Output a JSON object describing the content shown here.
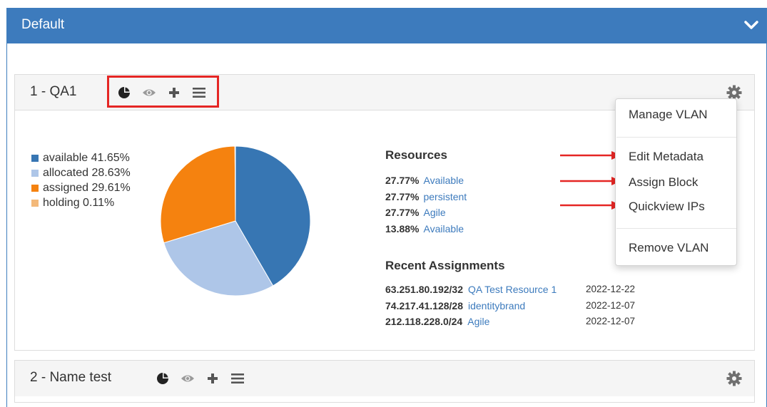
{
  "panel": {
    "title": "Default",
    "collapse_icon": "chevron-down-icon"
  },
  "vlans": [
    {
      "name": "1 - QA1",
      "tools": [
        "pie-chart-icon",
        "eye-icon",
        "plus-icon",
        "hamburger-menu-icon"
      ],
      "settings_icon": "gear-icon",
      "chart_data": {
        "type": "pie",
        "categories": [
          "available",
          "allocated",
          "assigned",
          "holding"
        ],
        "values": [
          41.65,
          28.63,
          29.61,
          0.11
        ],
        "legend": [
          "available 41.65%",
          "allocated 28.63%",
          "assigned 29.61%",
          "holding 0.11%"
        ],
        "colors": [
          "#3776b3",
          "#aec6e8",
          "#f5820f",
          "#f3b97a"
        ],
        "legend_position": "left"
      },
      "resources": {
        "title": "Resources",
        "rows": [
          {
            "pct": "27.77%",
            "name": "Available"
          },
          {
            "pct": "27.77%",
            "name": "persistent"
          },
          {
            "pct": "27.77%",
            "name": "Agile"
          },
          {
            "pct": "13.88%",
            "name": "Available"
          }
        ]
      },
      "recent": {
        "title": "Recent Assignments",
        "rows": [
          {
            "block": "63.251.80.192/32",
            "name": "QA Test Resource 1",
            "date": "2022-12-22"
          },
          {
            "block": "74.217.41.128/28",
            "name": "identitybrand",
            "date": "2022-12-07"
          },
          {
            "block": "212.118.228.0/24",
            "name": "Agile",
            "date": "2022-12-07"
          }
        ]
      }
    },
    {
      "name": "2 - Name test",
      "tools": [
        "pie-chart-icon",
        "eye-icon",
        "plus-icon",
        "hamburger-menu-icon"
      ],
      "settings_icon": "gear-icon"
    }
  ],
  "menu": {
    "items": [
      "Manage VLAN",
      "Edit Metadata",
      "Assign Block",
      "Quickview IPs",
      "Remove VLAN"
    ]
  },
  "colors": {
    "header": "#3d7bbd",
    "link": "#3d7bbd",
    "highlight": "#e52624"
  }
}
